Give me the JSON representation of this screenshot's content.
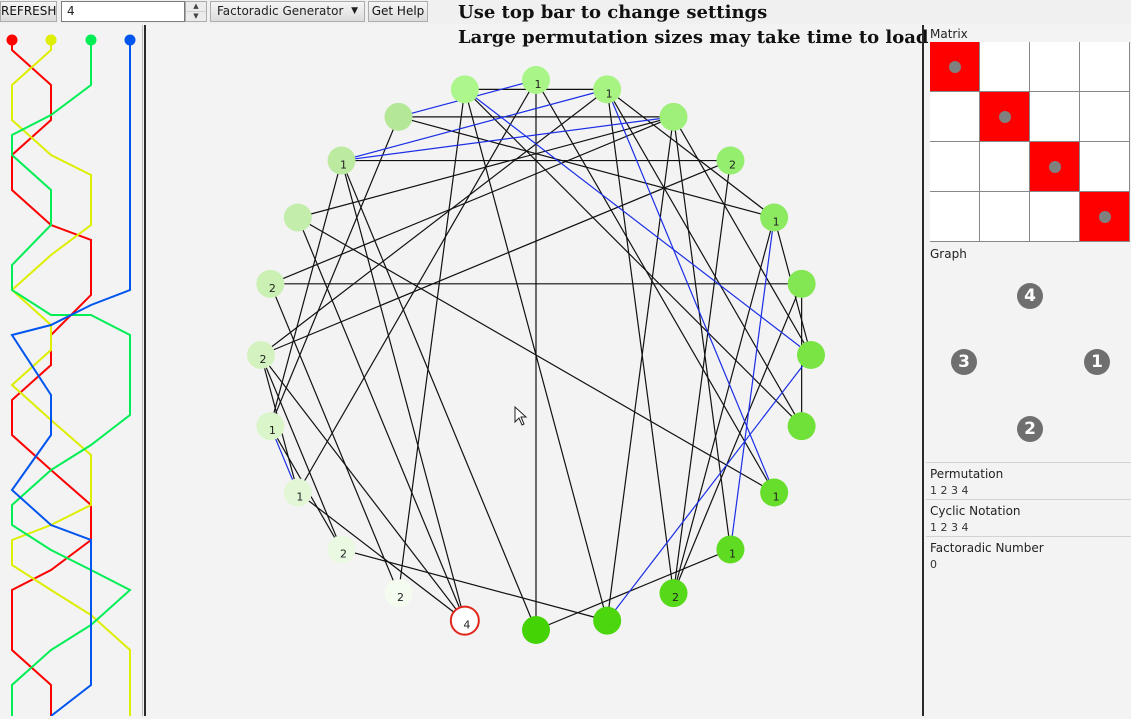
{
  "toolbar": {
    "refresh_label": "REFRESH",
    "size_value": "4",
    "mode_selected": "Factoradic Generator",
    "help_label": "Get Help"
  },
  "instructions": {
    "line1": "Use top bar to change settings",
    "line2": "Large permutation sizes may take time to load"
  },
  "wires": {
    "colors": [
      "#ff0000",
      "#ddee00",
      "#00ee55",
      "#0055ee"
    ]
  },
  "graph": {
    "nodes": [
      {
        "label": "1",
        "color": "#a7f483"
      },
      {
        "label": "",
        "color": "#9ff07a"
      },
      {
        "label": "2",
        "color": "#96ee6e"
      },
      {
        "label": "1",
        "color": "#8bea5f"
      },
      {
        "label": "",
        "color": "#82e753"
      },
      {
        "label": "",
        "color": "#79e444"
      },
      {
        "label": "",
        "color": "#70e138"
      },
      {
        "label": "1",
        "color": "#68de2c"
      },
      {
        "label": "1",
        "color": "#5fdb22"
      },
      {
        "label": "2",
        "color": "#56d918"
      },
      {
        "label": "",
        "color": "#4cd60e"
      },
      {
        "label": "",
        "color": "#44d305"
      },
      {
        "label": "4",
        "color": "#ffffff",
        "highlight": true
      },
      {
        "label": "2",
        "color": "#f3fcee"
      },
      {
        "label": "2",
        "color": "#eaf9e1"
      },
      {
        "label": "1",
        "color": "#e3f7d7"
      },
      {
        "label": "1",
        "color": "#dbf5cb"
      },
      {
        "label": "2",
        "color": "#d3f2c0"
      },
      {
        "label": "2",
        "color": "#cbf0b4"
      },
      {
        "label": "",
        "color": "#c3edab"
      },
      {
        "label": "1",
        "color": "#bbeaa0"
      },
      {
        "label": "",
        "color": "#b4e896"
      },
      {
        "label": "",
        "color": "#acf68b"
      },
      {
        "label": "1",
        "color": "#a9f587"
      }
    ]
  },
  "matrix": {
    "label": "Matrix",
    "filled": [
      [
        0,
        0
      ],
      [
        1,
        1
      ],
      [
        2,
        2
      ],
      [
        3,
        3
      ]
    ]
  },
  "graph_panel": {
    "label": "Graph",
    "nodes": [
      "4",
      "3",
      "1",
      "2"
    ]
  },
  "permutation": {
    "label": "Permutation",
    "value": "1 2 3 4"
  },
  "cyclic": {
    "label": "Cyclic Notation",
    "value": "1 2 3 4"
  },
  "factoradic": {
    "label": "Factoradic Number",
    "value": "0"
  }
}
